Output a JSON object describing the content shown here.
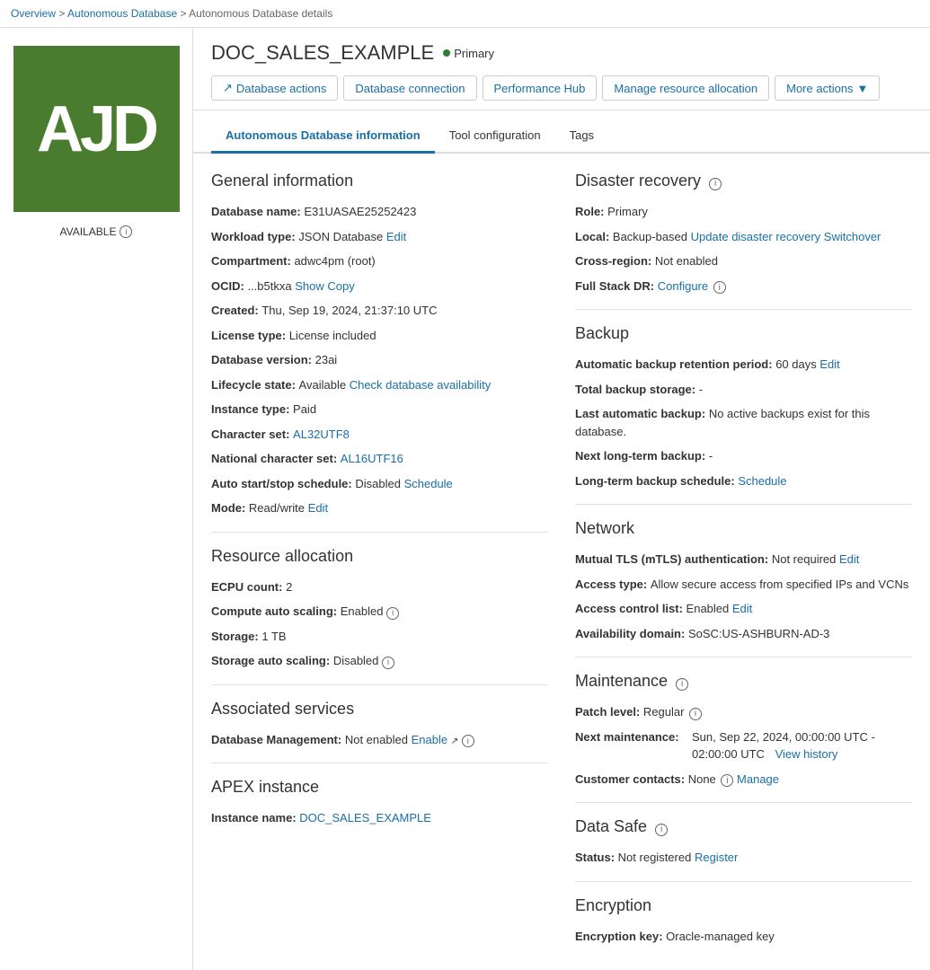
{
  "breadcrumb": {
    "items": [
      {
        "label": "Overview",
        "href": "#"
      },
      {
        "label": "Autonomous Database",
        "href": "#"
      },
      {
        "label": "Autonomous Database details",
        "href": null
      }
    ]
  },
  "sidebar": {
    "logo_letters": "AJD",
    "status": "AVAILABLE",
    "info_tooltip": "i"
  },
  "header": {
    "db_name": "DOC_SALES_EXAMPLE",
    "primary_label": "Primary",
    "buttons": {
      "database_actions": "Database actions",
      "database_connection": "Database connection",
      "performance_hub": "Performance Hub",
      "manage_resource": "Manage resource allocation",
      "more_actions": "More actions"
    }
  },
  "tabs": [
    {
      "label": "Autonomous Database information",
      "active": true
    },
    {
      "label": "Tool configuration",
      "active": false
    },
    {
      "label": "Tags",
      "active": false
    }
  ],
  "general_info": {
    "title": "General information",
    "fields": [
      {
        "label": "Database name:",
        "value": "E31UASAE25252423",
        "links": []
      },
      {
        "label": "Workload type:",
        "value": "JSON Database",
        "links": [
          {
            "text": "Edit",
            "href": "#"
          }
        ]
      },
      {
        "label": "Compartment:",
        "value": "adwc4pm (root)",
        "links": []
      },
      {
        "label": "OCID:",
        "value": "...b5tkxa",
        "links": [
          {
            "text": "Show",
            "href": "#"
          },
          {
            "text": "Copy",
            "href": "#"
          }
        ]
      },
      {
        "label": "Created:",
        "value": "Thu, Sep 19, 2024, 21:37:10 UTC",
        "links": []
      },
      {
        "label": "License type:",
        "value": "License included",
        "links": []
      },
      {
        "label": "Database version:",
        "value": "23ai",
        "links": []
      },
      {
        "label": "Lifecycle state:",
        "value": "Available",
        "links": [
          {
            "text": "Check database availability",
            "href": "#"
          }
        ]
      },
      {
        "label": "Instance type:",
        "value": "Paid",
        "links": []
      },
      {
        "label": "Character set:",
        "value": "AL32UTF8",
        "links": [],
        "value_link": true
      },
      {
        "label": "National character set:",
        "value": "AL16UTF16",
        "links": [],
        "value_link": true
      },
      {
        "label": "Auto start/stop schedule:",
        "value": "Disabled",
        "links": [
          {
            "text": "Schedule",
            "href": "#"
          }
        ]
      },
      {
        "label": "Mode:",
        "value": "Read/write",
        "links": [
          {
            "text": "Edit",
            "href": "#"
          }
        ]
      }
    ]
  },
  "resource_allocation": {
    "title": "Resource allocation",
    "fields": [
      {
        "label": "ECPU count:",
        "value": "2",
        "links": []
      },
      {
        "label": "Compute auto scaling:",
        "value": "Enabled",
        "has_info": true,
        "links": []
      },
      {
        "label": "Storage:",
        "value": "1 TB",
        "links": []
      },
      {
        "label": "Storage auto scaling:",
        "value": "Disabled",
        "has_info": true,
        "links": []
      }
    ]
  },
  "associated_services": {
    "title": "Associated services",
    "fields": [
      {
        "label": "Database Management:",
        "value": "Not enabled",
        "links": [
          {
            "text": "Enable",
            "href": "#",
            "has_external": true
          }
        ],
        "has_info": true
      }
    ]
  },
  "apex_instance": {
    "title": "APEX instance",
    "fields": [
      {
        "label": "Instance name:",
        "value": "DOC_SALES_EXAMPLE",
        "value_link": true
      }
    ]
  },
  "disaster_recovery": {
    "title": "Disaster recovery",
    "has_info": true,
    "fields": [
      {
        "label": "Role:",
        "value": "Primary",
        "links": []
      },
      {
        "label": "Local:",
        "value": "Backup-based",
        "links": [
          {
            "text": "Update disaster recovery",
            "href": "#"
          },
          {
            "text": "Switchover",
            "href": "#"
          }
        ]
      },
      {
        "label": "Cross-region:",
        "value": "Not enabled",
        "links": []
      },
      {
        "label": "Full Stack DR:",
        "value": "",
        "links": [
          {
            "text": "Configure",
            "href": "#"
          }
        ],
        "has_info": true
      }
    ]
  },
  "backup": {
    "title": "Backup",
    "fields": [
      {
        "label": "Automatic backup retention period:",
        "value": "60 days",
        "links": [
          {
            "text": "Edit",
            "href": "#"
          }
        ]
      },
      {
        "label": "Total backup storage:",
        "value": "-",
        "links": []
      },
      {
        "label": "Last automatic backup:",
        "value": "No active backups exist for this database.",
        "links": []
      },
      {
        "label": "Next long-term backup:",
        "value": "-",
        "links": []
      },
      {
        "label": "Long-term backup schedule:",
        "value": "",
        "links": [
          {
            "text": "Schedule",
            "href": "#"
          }
        ]
      }
    ]
  },
  "network": {
    "title": "Network",
    "fields": [
      {
        "label": "Mutual TLS (mTLS) authentication:",
        "value": "Not required",
        "links": [
          {
            "text": "Edit",
            "href": "#"
          }
        ]
      },
      {
        "label": "Access type:",
        "value": "Allow secure access from specified IPs and VCNs",
        "links": []
      },
      {
        "label": "Access control list:",
        "value": "Enabled",
        "links": [
          {
            "text": "Edit",
            "href": "#"
          }
        ]
      },
      {
        "label": "Availability domain:",
        "value": "SoSC:US-ASHBURN-AD-3",
        "links": []
      }
    ]
  },
  "maintenance": {
    "title": "Maintenance",
    "has_info": true,
    "fields": [
      {
        "label": "Patch level:",
        "value": "Regular",
        "has_info": true,
        "links": []
      },
      {
        "label": "Next maintenance:",
        "value": "Sun, Sep 22, 2024, 00:00:00 UTC - 02:00:00 UTC",
        "links": [
          {
            "text": "View history",
            "href": "#"
          }
        ]
      },
      {
        "label": "Customer contacts:",
        "value": "None",
        "links": [
          {
            "text": "Manage",
            "href": "#"
          }
        ],
        "has_info": true
      }
    ]
  },
  "data_safe": {
    "title": "Data Safe",
    "has_info": true,
    "fields": [
      {
        "label": "Status:",
        "value": "Not registered",
        "links": [
          {
            "text": "Register",
            "href": "#"
          }
        ]
      }
    ]
  },
  "encryption": {
    "title": "Encryption",
    "fields": [
      {
        "label": "Encryption key:",
        "value": "Oracle-managed key",
        "links": []
      }
    ]
  }
}
